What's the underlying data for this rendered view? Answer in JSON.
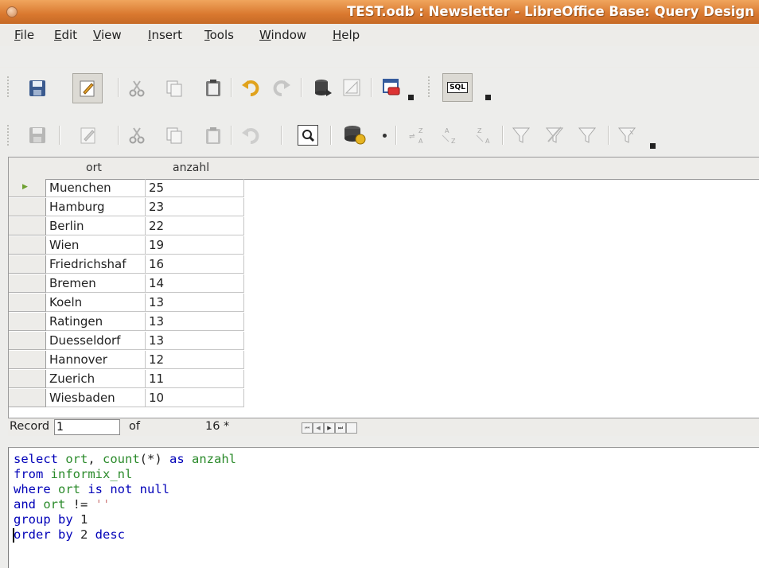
{
  "window": {
    "title": "TEST.odb : Newsletter - LibreOffice Base: Query Design"
  },
  "menu": [
    {
      "label": "File",
      "key": "F",
      "rest": "ile"
    },
    {
      "label": "Edit",
      "key": "E",
      "rest": "dit"
    },
    {
      "label": "View",
      "key": "V",
      "rest": "iew"
    },
    {
      "label": "Insert",
      "key": "I",
      "rest": "nsert"
    },
    {
      "label": "Tools",
      "key": "T",
      "rest": "ools"
    },
    {
      "label": "Window",
      "key": "W",
      "rest": "indow"
    },
    {
      "label": "Help",
      "key": "H",
      "rest": "elp"
    }
  ],
  "toolbar1": {
    "icons": [
      "save-icon",
      "edit-mode-icon",
      "cut-icon",
      "copy-icon",
      "paste-icon",
      "undo-icon",
      "redo-icon",
      "database-run-icon",
      "design-view-icon",
      "add-table-icon",
      "sql-view-icon"
    ],
    "sql_label": "SQL"
  },
  "toolbar2": {
    "icons": [
      "save-record-icon",
      "edit-data-icon",
      "cut-icon",
      "copy-icon",
      "paste-icon",
      "undo-icon",
      "find-record-icon",
      "refresh-icon",
      "sort-icon",
      "sort-ascending-icon",
      "sort-descending-icon",
      "autofilter-icon",
      "apply-filter-icon",
      "standard-filter-icon",
      "reset-filter-icon"
    ]
  },
  "grid": {
    "columns": [
      "ort",
      "anzahl"
    ],
    "rows": [
      [
        "Muenchen",
        "25"
      ],
      [
        "Hamburg",
        "23"
      ],
      [
        "Berlin",
        "22"
      ],
      [
        "Wien",
        "19"
      ],
      [
        "Friedrichshaf",
        "16"
      ],
      [
        "Bremen",
        "14"
      ],
      [
        "Koeln",
        "13"
      ],
      [
        "Ratingen",
        "13"
      ],
      [
        "Duesseldorf",
        "13"
      ],
      [
        "Hannover",
        "12"
      ],
      [
        "Zuerich",
        "11"
      ],
      [
        "Wiesbaden",
        "10"
      ]
    ],
    "current_row_marker": "▶"
  },
  "navigation": {
    "record_label": "Record",
    "record_value": "1",
    "of_label": "of",
    "total": "16 *"
  },
  "sql": {
    "lines": [
      [
        [
          "kw",
          "select "
        ],
        [
          "id",
          "ort"
        ],
        [
          "num",
          ", "
        ],
        [
          "id",
          "count"
        ],
        [
          "num",
          "(*) "
        ],
        [
          "kw",
          "as "
        ],
        [
          "id",
          "anzahl"
        ]
      ],
      [
        [
          "kw",
          "from "
        ],
        [
          "id",
          "informix_nl"
        ]
      ],
      [
        [
          "kw",
          "where "
        ],
        [
          "id",
          "ort "
        ],
        [
          "kw",
          "is not null"
        ]
      ],
      [
        [
          "kw",
          "and "
        ],
        [
          "id",
          "ort "
        ],
        [
          "num",
          "!= "
        ],
        [
          "str",
          "''"
        ]
      ],
      [
        [
          "kw",
          "group by "
        ],
        [
          "num",
          "1"
        ]
      ],
      [
        [
          "kw",
          "order by "
        ],
        [
          "num",
          "2 "
        ],
        [
          "kw",
          "desc"
        ]
      ]
    ]
  },
  "colors": {
    "title_bar": "#d9782f",
    "keyword": "#0000b8",
    "identifier": "#2a8a2a",
    "string": "#d08282"
  }
}
